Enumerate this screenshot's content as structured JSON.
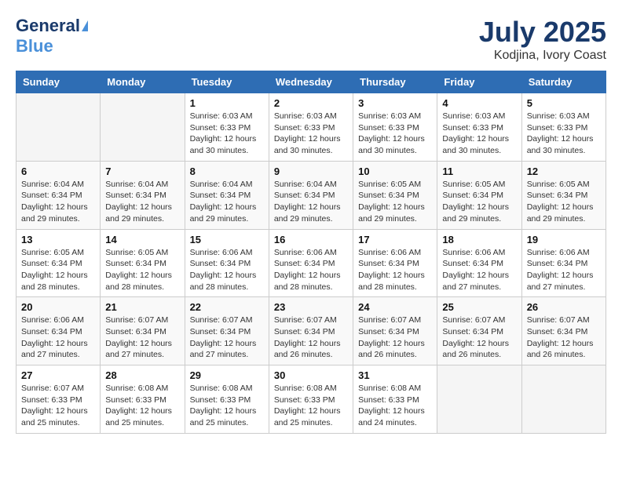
{
  "header": {
    "logo_general": "General",
    "logo_blue": "Blue",
    "month_title": "July 2025",
    "location": "Kodjina, Ivory Coast"
  },
  "weekdays": [
    "Sunday",
    "Monday",
    "Tuesday",
    "Wednesday",
    "Thursday",
    "Friday",
    "Saturday"
  ],
  "weeks": [
    [
      {
        "day": "",
        "info": ""
      },
      {
        "day": "",
        "info": ""
      },
      {
        "day": "1",
        "info": "Sunrise: 6:03 AM\nSunset: 6:33 PM\nDaylight: 12 hours and 30 minutes."
      },
      {
        "day": "2",
        "info": "Sunrise: 6:03 AM\nSunset: 6:33 PM\nDaylight: 12 hours and 30 minutes."
      },
      {
        "day": "3",
        "info": "Sunrise: 6:03 AM\nSunset: 6:33 PM\nDaylight: 12 hours and 30 minutes."
      },
      {
        "day": "4",
        "info": "Sunrise: 6:03 AM\nSunset: 6:33 PM\nDaylight: 12 hours and 30 minutes."
      },
      {
        "day": "5",
        "info": "Sunrise: 6:03 AM\nSunset: 6:33 PM\nDaylight: 12 hours and 30 minutes."
      }
    ],
    [
      {
        "day": "6",
        "info": "Sunrise: 6:04 AM\nSunset: 6:34 PM\nDaylight: 12 hours and 29 minutes."
      },
      {
        "day": "7",
        "info": "Sunrise: 6:04 AM\nSunset: 6:34 PM\nDaylight: 12 hours and 29 minutes."
      },
      {
        "day": "8",
        "info": "Sunrise: 6:04 AM\nSunset: 6:34 PM\nDaylight: 12 hours and 29 minutes."
      },
      {
        "day": "9",
        "info": "Sunrise: 6:04 AM\nSunset: 6:34 PM\nDaylight: 12 hours and 29 minutes."
      },
      {
        "day": "10",
        "info": "Sunrise: 6:05 AM\nSunset: 6:34 PM\nDaylight: 12 hours and 29 minutes."
      },
      {
        "day": "11",
        "info": "Sunrise: 6:05 AM\nSunset: 6:34 PM\nDaylight: 12 hours and 29 minutes."
      },
      {
        "day": "12",
        "info": "Sunrise: 6:05 AM\nSunset: 6:34 PM\nDaylight: 12 hours and 29 minutes."
      }
    ],
    [
      {
        "day": "13",
        "info": "Sunrise: 6:05 AM\nSunset: 6:34 PM\nDaylight: 12 hours and 28 minutes."
      },
      {
        "day": "14",
        "info": "Sunrise: 6:05 AM\nSunset: 6:34 PM\nDaylight: 12 hours and 28 minutes."
      },
      {
        "day": "15",
        "info": "Sunrise: 6:06 AM\nSunset: 6:34 PM\nDaylight: 12 hours and 28 minutes."
      },
      {
        "day": "16",
        "info": "Sunrise: 6:06 AM\nSunset: 6:34 PM\nDaylight: 12 hours and 28 minutes."
      },
      {
        "day": "17",
        "info": "Sunrise: 6:06 AM\nSunset: 6:34 PM\nDaylight: 12 hours and 28 minutes."
      },
      {
        "day": "18",
        "info": "Sunrise: 6:06 AM\nSunset: 6:34 PM\nDaylight: 12 hours and 27 minutes."
      },
      {
        "day": "19",
        "info": "Sunrise: 6:06 AM\nSunset: 6:34 PM\nDaylight: 12 hours and 27 minutes."
      }
    ],
    [
      {
        "day": "20",
        "info": "Sunrise: 6:06 AM\nSunset: 6:34 PM\nDaylight: 12 hours and 27 minutes."
      },
      {
        "day": "21",
        "info": "Sunrise: 6:07 AM\nSunset: 6:34 PM\nDaylight: 12 hours and 27 minutes."
      },
      {
        "day": "22",
        "info": "Sunrise: 6:07 AM\nSunset: 6:34 PM\nDaylight: 12 hours and 27 minutes."
      },
      {
        "day": "23",
        "info": "Sunrise: 6:07 AM\nSunset: 6:34 PM\nDaylight: 12 hours and 26 minutes."
      },
      {
        "day": "24",
        "info": "Sunrise: 6:07 AM\nSunset: 6:34 PM\nDaylight: 12 hours and 26 minutes."
      },
      {
        "day": "25",
        "info": "Sunrise: 6:07 AM\nSunset: 6:34 PM\nDaylight: 12 hours and 26 minutes."
      },
      {
        "day": "26",
        "info": "Sunrise: 6:07 AM\nSunset: 6:34 PM\nDaylight: 12 hours and 26 minutes."
      }
    ],
    [
      {
        "day": "27",
        "info": "Sunrise: 6:07 AM\nSunset: 6:33 PM\nDaylight: 12 hours and 25 minutes."
      },
      {
        "day": "28",
        "info": "Sunrise: 6:08 AM\nSunset: 6:33 PM\nDaylight: 12 hours and 25 minutes."
      },
      {
        "day": "29",
        "info": "Sunrise: 6:08 AM\nSunset: 6:33 PM\nDaylight: 12 hours and 25 minutes."
      },
      {
        "day": "30",
        "info": "Sunrise: 6:08 AM\nSunset: 6:33 PM\nDaylight: 12 hours and 25 minutes."
      },
      {
        "day": "31",
        "info": "Sunrise: 6:08 AM\nSunset: 6:33 PM\nDaylight: 12 hours and 24 minutes."
      },
      {
        "day": "",
        "info": ""
      },
      {
        "day": "",
        "info": ""
      }
    ]
  ]
}
